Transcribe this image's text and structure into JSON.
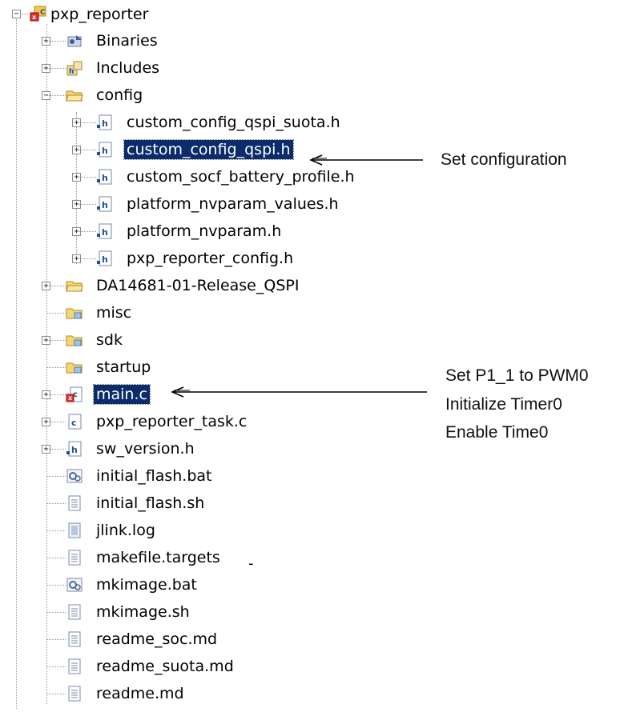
{
  "tree": {
    "root": {
      "label": "pxp_reporter",
      "expander": "−"
    },
    "items": [
      {
        "label": "Binaries",
        "icon": "binaries-icon",
        "expander": "+"
      },
      {
        "label": "Includes",
        "icon": "includes-icon",
        "expander": "+"
      },
      {
        "label": "config",
        "icon": "folder-open-icon",
        "expander": "−"
      },
      {
        "label": "custom_config_qspi_suota.h",
        "icon": "header-file-icon",
        "expander": "+"
      },
      {
        "label": "custom_config_qspi.h",
        "icon": "header-file-icon",
        "expander": "+",
        "selected": true
      },
      {
        "label": "custom_socf_battery_profile.h",
        "icon": "header-file-icon",
        "expander": "+"
      },
      {
        "label": "platform_nvparam_values.h",
        "icon": "header-file-icon",
        "expander": "+"
      },
      {
        "label": "platform_nvparam.h",
        "icon": "header-file-icon",
        "expander": "+"
      },
      {
        "label": "pxp_reporter_config.h",
        "icon": "header-file-icon",
        "expander": "+"
      },
      {
        "label": "DA14681-01-Release_QSPI",
        "icon": "folder-icon",
        "expander": "+"
      },
      {
        "label": "misc",
        "icon": "linked-folder-icon",
        "expander": ""
      },
      {
        "label": "sdk",
        "icon": "linked-folder-icon",
        "expander": "+"
      },
      {
        "label": "startup",
        "icon": "linked-folder-icon",
        "expander": ""
      },
      {
        "label": "main.c",
        "icon": "c-file-error-icon",
        "expander": "+",
        "selected": true
      },
      {
        "label": "pxp_reporter_task.c",
        "icon": "c-file-icon",
        "expander": "+"
      },
      {
        "label": "sw_version.h",
        "icon": "header-file-icon",
        "expander": "+"
      },
      {
        "label": "initial_flash.bat",
        "icon": "bat-file-icon",
        "expander": ""
      },
      {
        "label": "initial_flash.sh",
        "icon": "text-file-icon",
        "expander": ""
      },
      {
        "label": "jlink.log",
        "icon": "log-file-icon",
        "expander": ""
      },
      {
        "label": "makefile.targets",
        "icon": "text-file-icon",
        "expander": ""
      },
      {
        "label": "mkimage.bat",
        "icon": "bat-file-icon",
        "expander": ""
      },
      {
        "label": "mkimage.sh",
        "icon": "text-file-icon",
        "expander": ""
      },
      {
        "label": "readme_soc.md",
        "icon": "text-file-icon",
        "expander": ""
      },
      {
        "label": "readme_suota.md",
        "icon": "text-file-icon",
        "expander": ""
      },
      {
        "label": "readme.md",
        "icon": "text-file-icon",
        "expander": ""
      }
    ]
  },
  "annotations": {
    "config_note": "Set  configuration",
    "main_note_1": "Set  P1_1 to PWM0",
    "main_note_2": "Initialize Timer0",
    "main_note_3": "Enable Time0",
    "stray_dash": "-"
  },
  "colors": {
    "selection": "#0b2b6b",
    "folder": "#f2c94c",
    "header_blue": "#1f4e9a"
  }
}
